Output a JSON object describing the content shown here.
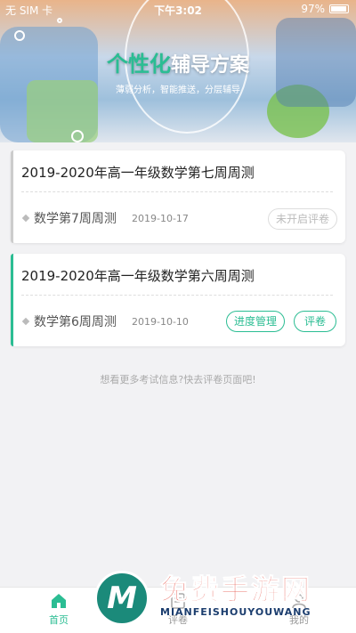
{
  "status_bar": {
    "carrier": "无 SIM 卡",
    "time": "下午3:02",
    "battery": "97%"
  },
  "banner": {
    "title_big": "个性化",
    "title_rest": "辅导方案",
    "subtitle": "薄弱分析，智能推送，分层辅导"
  },
  "exams": [
    {
      "title": "2019-2020年高一年级数学第七周周测",
      "subject": "数学第7周周测",
      "date": "2019-10-17",
      "buttons": [
        "未开启评卷"
      ],
      "accent": "#cccccc"
    },
    {
      "title": "2019-2020年高一年级数学第六周周测",
      "subject": "数学第6周周测",
      "date": "2019-10-10",
      "buttons": [
        "进度管理",
        "评卷"
      ],
      "accent": "#2bbd93"
    }
  ],
  "hint": "想看更多考试信息?快去评卷页面吧!",
  "tabbar": {
    "items": [
      {
        "label": "首页",
        "icon": "home-icon",
        "active": true
      },
      {
        "label": "评卷",
        "icon": "grade-icon",
        "active": false
      },
      {
        "label": "我的",
        "icon": "user-icon",
        "active": false
      }
    ]
  },
  "colors": {
    "accent": "#2bbd93",
    "disabled": "#cccccc",
    "watermark_red": "#e23a2e"
  },
  "watermark": {
    "logo_letter": "M",
    "title": "免费手游网",
    "subtitle": "MIANFEISHOUYOUWANG"
  }
}
